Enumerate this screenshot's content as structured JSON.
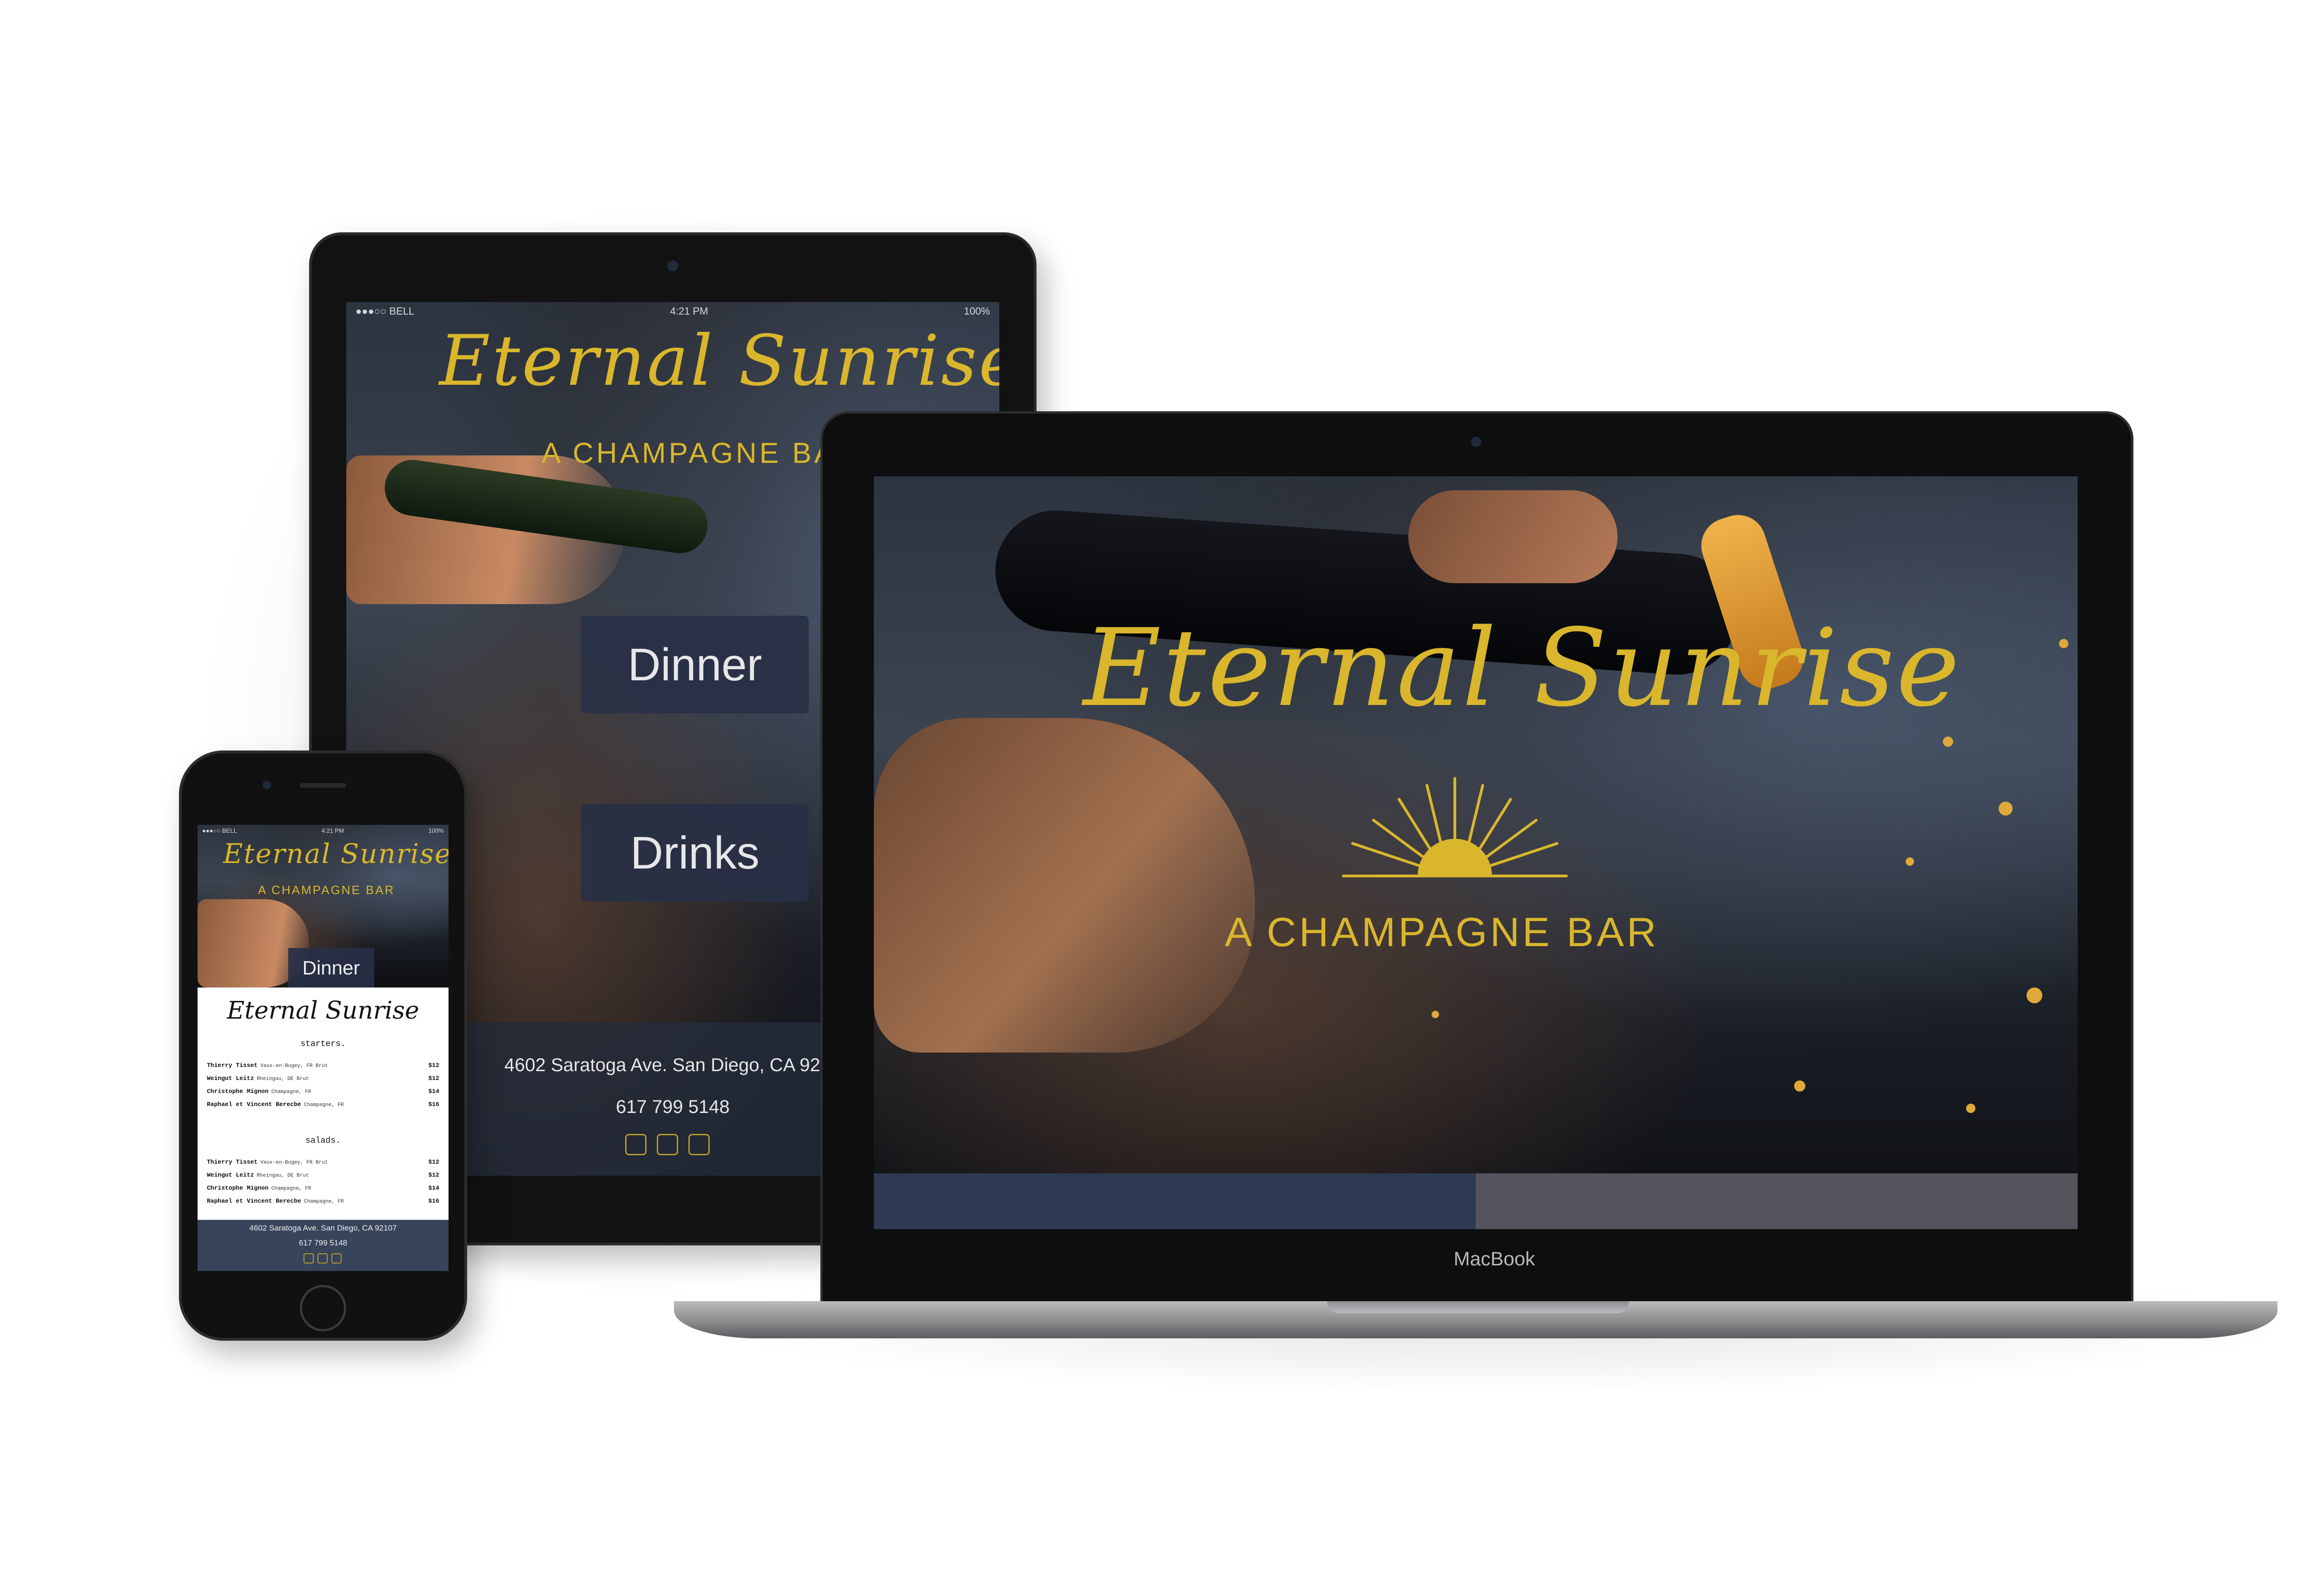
{
  "site": {
    "name": "Eternal Sunrise",
    "tagline": "A CHAMPAGNE BAR"
  },
  "status_bar": {
    "carrier": "●●●○○ BELL",
    "time": "4:21 PM",
    "battery": "100%"
  },
  "tablet": {
    "nav": {
      "dinner": "Dinner",
      "drinks": "Drinks"
    },
    "footer": {
      "address": "4602 Saratoga Ave. San Diego, CA 92107",
      "phone": "617 799 5148"
    }
  },
  "laptop": {
    "brand_label": "MacBook"
  },
  "phone": {
    "nav": {
      "dinner": "Dinner"
    },
    "menu": {
      "title": "Eternal Sunrise",
      "sections": [
        {
          "heading": "starters.",
          "items": [
            {
              "name": "Thierry Tisset",
              "origin": "Vaux-en-Bugey, FR Brut",
              "price": "$12"
            },
            {
              "name": "Weingut Leitz",
              "origin": "Rheingau, DE Brut",
              "price": "$12"
            },
            {
              "name": "Christophe Mignon",
              "origin": "Champagne, FR",
              "price": "$14"
            },
            {
              "name": "Raphael et Vincent Berecbe",
              "origin": "Champagne, FR",
              "price": "$16"
            }
          ]
        },
        {
          "heading": "salads.",
          "items": [
            {
              "name": "Thierry Tisset",
              "origin": "Vaux-en-Bugey, FR Brut",
              "price": "$12"
            },
            {
              "name": "Weingut Leitz",
              "origin": "Rheingau, DE Brut",
              "price": "$12"
            },
            {
              "name": "Christophe Mignon",
              "origin": "Champagne, FR",
              "price": "$14"
            },
            {
              "name": "Raphael et Vincent Berecbe",
              "origin": "Champagne, FR",
              "price": "$16"
            }
          ]
        }
      ]
    },
    "footer": {
      "address": "4602 Saratoga Ave. San Diego, CA 92107",
      "phone": "617 799 5148"
    }
  },
  "icons": [
    "facebook-icon",
    "foursquare-icon",
    "instagram-icon"
  ],
  "colors": {
    "gold": "#d9b62c",
    "nav_blue": "#2e3a52",
    "nav_grey": "#55545c",
    "footer_bg": "#37445a"
  }
}
